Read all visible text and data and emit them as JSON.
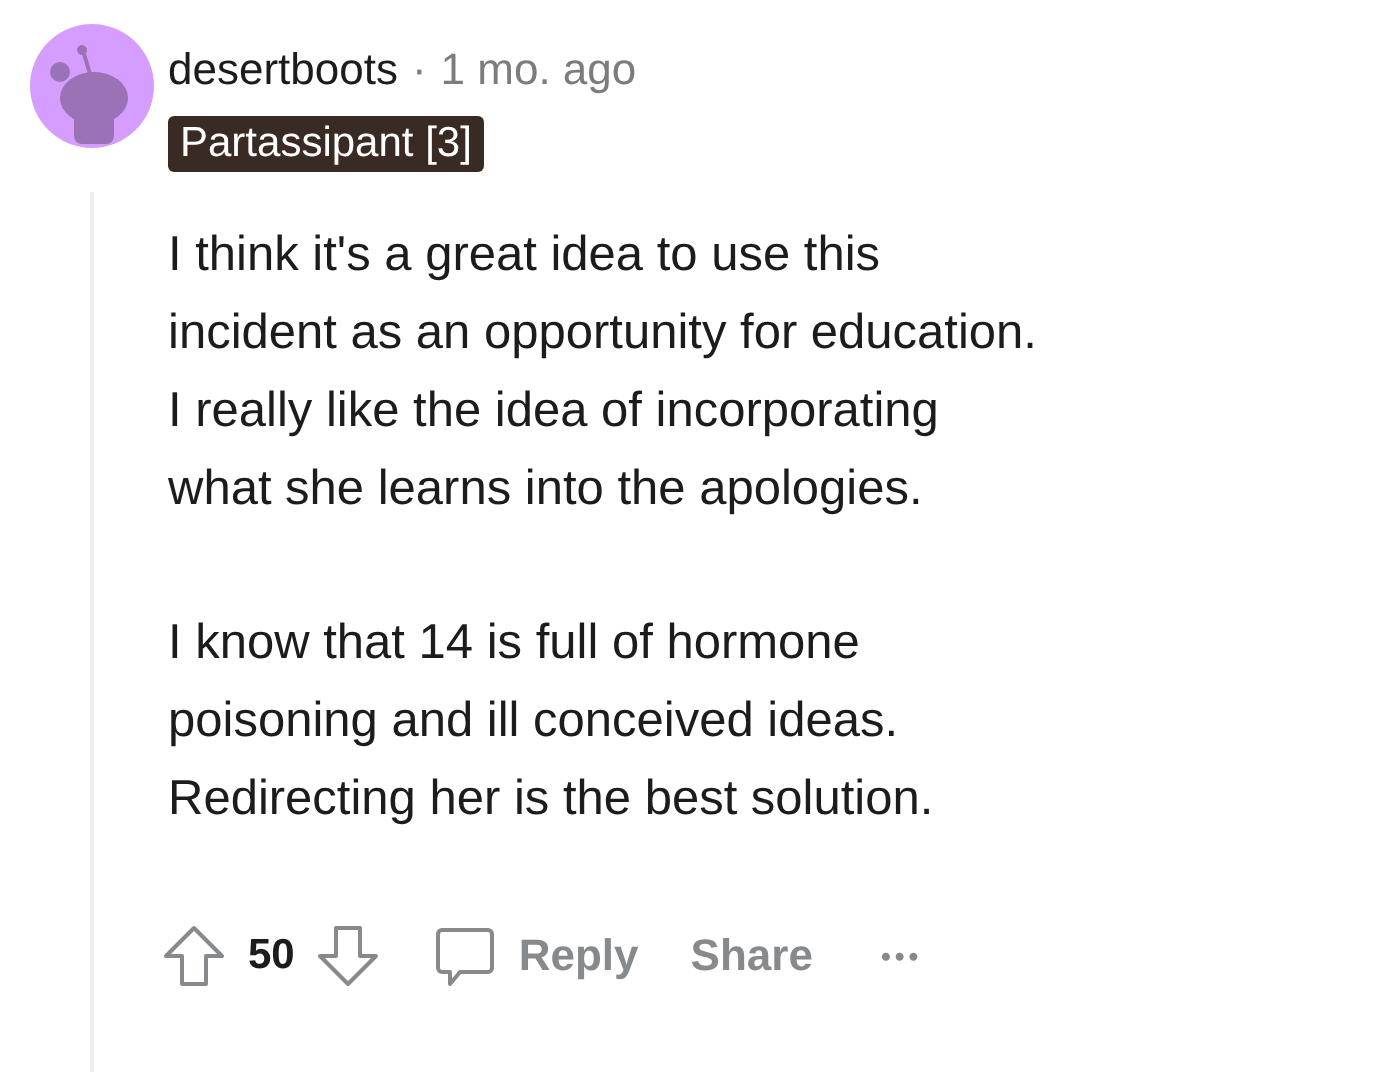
{
  "comment": {
    "author": "desertboots",
    "separator": "·",
    "time": "1 mo. ago",
    "flair": "Partassipant [3]",
    "paragraphs": [
      [
        "I think it's a great idea to use this",
        "incident as an opportunity for education.",
        "I really like the idea of incorporating",
        "what she learns into the apologies."
      ],
      [
        "I know that 14 is full of hormone",
        "poisoning and ill conceived ideas.",
        "Redirecting her is the best solution."
      ]
    ],
    "score": "50",
    "actions": [
      "Reply",
      "Share"
    ],
    "more": "•••"
  }
}
